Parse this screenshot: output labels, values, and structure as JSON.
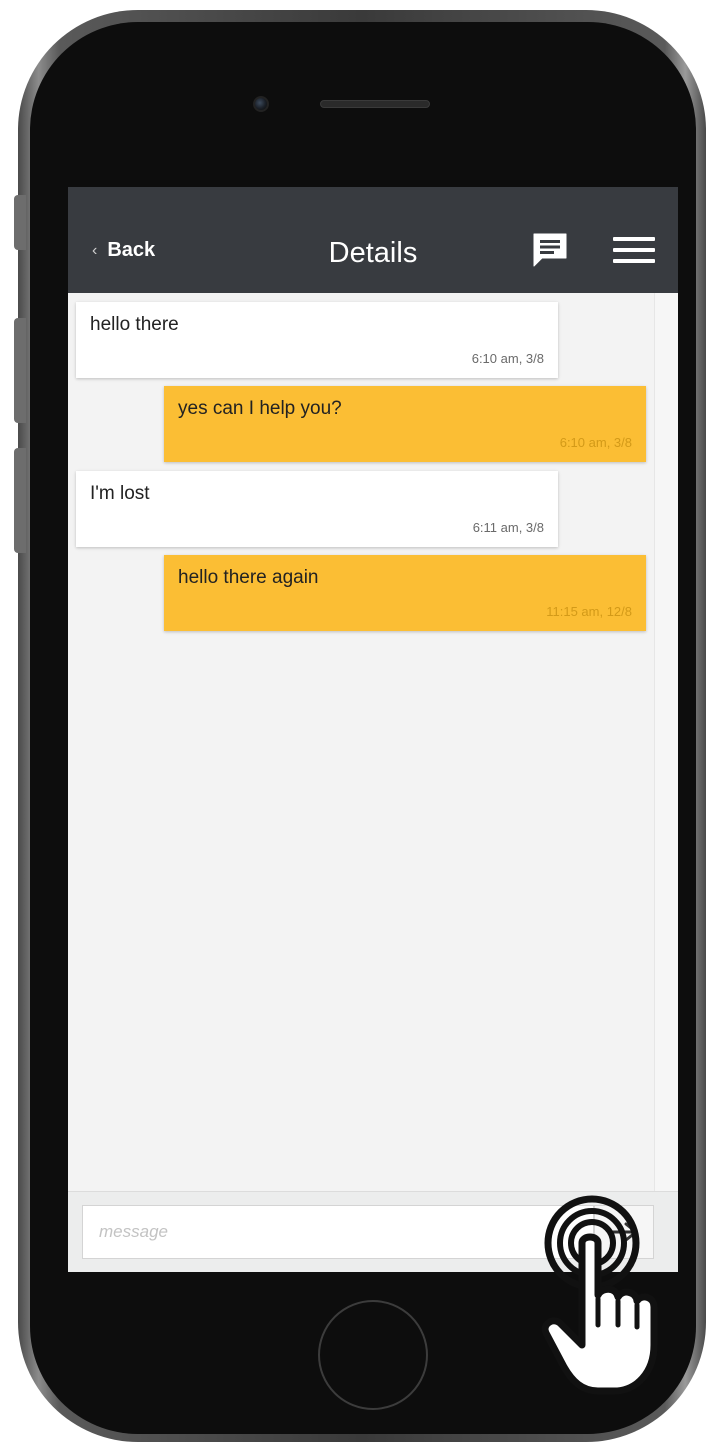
{
  "header": {
    "back_label": "Back",
    "title": "Details",
    "chat_icon": "chat-bubble-icon",
    "menu_icon": "hamburger-menu-icon"
  },
  "messages": [
    {
      "text": "hello there",
      "time": "6:10 am, 3/8",
      "from": "incoming"
    },
    {
      "text": "yes can I help you?",
      "time": "6:10 am, 3/8",
      "from": "outgoing"
    },
    {
      "text": "I'm lost",
      "time": "6:11 am, 3/8",
      "from": "incoming"
    },
    {
      "text": "hello there again",
      "time": "11:15 am, 12/8",
      "from": "outgoing"
    }
  ],
  "composer": {
    "placeholder": "message",
    "value": "",
    "send_icon": "send-arrow-icon"
  },
  "colors": {
    "appbar": "#383b40",
    "outgoing_bubble": "#fbbe34",
    "incoming_bubble": "#ffffff",
    "screen_background": "#f3f3f3"
  }
}
